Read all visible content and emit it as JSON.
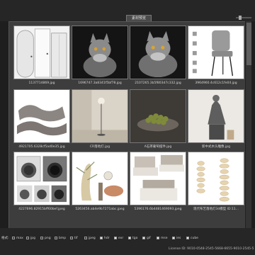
{
  "window": {
    "title_tab": "素材预览"
  },
  "tiles": [
    {
      "caption": "1137714869.jpg"
    },
    {
      "caption": "1696747.3a8341f5bf78.jpg"
    },
    {
      "caption": "2107265.3b5f803d7c332.jpg"
    },
    {
      "caption": "3964960.4c612c1fe04.jpg"
    },
    {
      "caption": "4921705.6328cf5ad0e35.jpg"
    },
    {
      "caption": "CR落地灯.jpg"
    },
    {
      "caption": "A石茶葡萄摆件.jpg"
    },
    {
      "caption": "新中式木头雕像.jpg"
    },
    {
      "caption": "4227696.82915bff60bef.jpeg"
    },
    {
      "caption": "5263456.ab4e9b7271abc.jpeg"
    },
    {
      "caption": "5396176.6b4481469093.jpeg"
    },
    {
      "caption": "现代布艺落地灯3d模型 ID:11..."
    }
  ],
  "filters": {
    "label": "格式:",
    "items": [
      {
        "label": "max",
        "checked": true
      },
      {
        "label": "jpg",
        "checked": true
      },
      {
        "label": "png",
        "checked": true
      },
      {
        "label": "bmp",
        "checked": true
      },
      {
        "label": "tif",
        "checked": true
      },
      {
        "label": "jpeg",
        "checked": true
      },
      {
        "label": "hdr",
        "checked": false
      },
      {
        "label": "exr",
        "checked": false
      },
      {
        "label": "tga",
        "checked": false
      },
      {
        "label": "gif",
        "checked": false
      },
      {
        "label": "mse",
        "checked": false
      },
      {
        "label": "ies",
        "checked": false
      },
      {
        "label": "cube",
        "checked": false
      }
    ]
  },
  "license": "License ID:     9010-0548-2545-5668-6655-9010-2545-5"
}
